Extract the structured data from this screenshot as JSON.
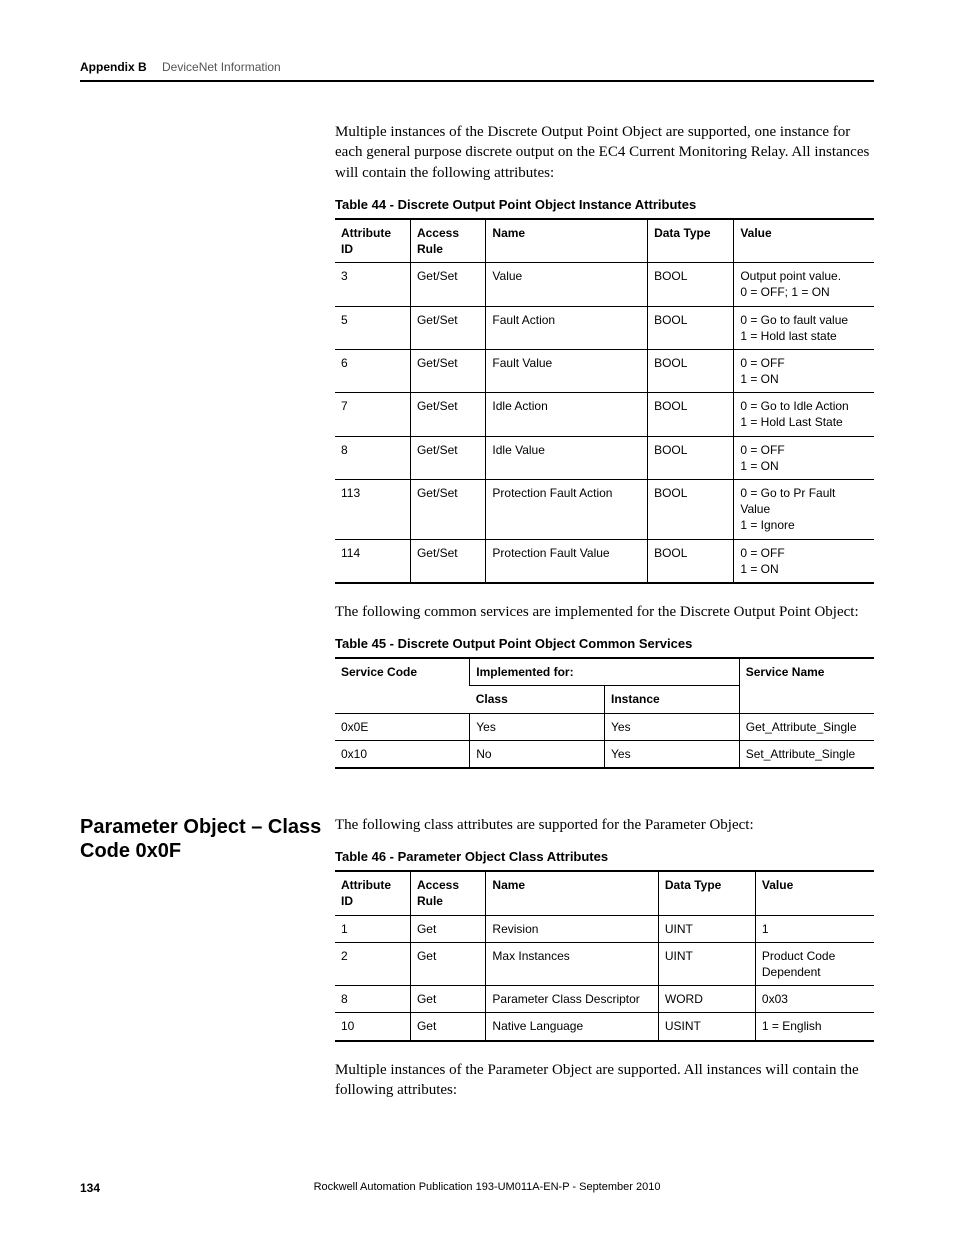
{
  "header": {
    "appendix": "Appendix B",
    "title": "DeviceNet Information"
  },
  "intro_para": "Multiple instances of the Discrete Output Point Object are supported, one instance for each general purpose discrete output on the EC4 Current Monitoring Relay. All instances will contain the following attributes:",
  "table44": {
    "caption": "Table 44 - Discrete Output Point Object Instance Attributes",
    "headers": [
      "Attribute ID",
      "Access Rule",
      "Name",
      "Data Type",
      "Value"
    ],
    "rows": [
      [
        "3",
        "Get/Set",
        "Value",
        "BOOL",
        "Output point value.\n0 = OFF; 1 = ON"
      ],
      [
        "5",
        "Get/Set",
        "Fault Action",
        "BOOL",
        "0 = Go to fault value\n1 = Hold last state"
      ],
      [
        "6",
        "Get/Set",
        "Fault Value",
        "BOOL",
        "0 = OFF\n1 = ON"
      ],
      [
        "7",
        "Get/Set",
        "Idle Action",
        "BOOL",
        "0 = Go to Idle Action\n1 = Hold Last State"
      ],
      [
        "8",
        "Get/Set",
        "Idle Value",
        "BOOL",
        "0 = OFF\n1 = ON"
      ],
      [
        "113",
        "Get/Set",
        "Protection Fault Action",
        "BOOL",
        "0 = Go to Pr Fault Value\n1 = Ignore"
      ],
      [
        "114",
        "Get/Set",
        "Protection Fault Value",
        "BOOL",
        "0 = OFF\n1 = ON"
      ]
    ]
  },
  "para_after_44": "The following common services are implemented for the Discrete Output Point Object:",
  "table45": {
    "caption": "Table 45 - Discrete Output Point Object Common Services",
    "header_row1": {
      "c1": "Service Code",
      "c2": "Implemented for:",
      "c3": "Service Name"
    },
    "header_row2": {
      "c1": "Class",
      "c2": "Instance"
    },
    "rows": [
      [
        "0x0E",
        "Yes",
        "Yes",
        "Get_Attribute_Single"
      ],
      [
        "0x10",
        "No",
        "Yes",
        "Set_Attribute_Single"
      ]
    ]
  },
  "section_heading": "Parameter Object – Class Code 0x0F",
  "para_param_intro": "The following class attributes are supported for the Parameter Object:",
  "table46": {
    "caption": "Table 46 - Parameter Object Class Attributes",
    "headers": [
      "Attribute ID",
      "Access Rule",
      "Name",
      "Data Type",
      "Value"
    ],
    "rows": [
      [
        "1",
        "Get",
        "Revision",
        "UINT",
        "1"
      ],
      [
        "2",
        "Get",
        "Max Instances",
        "UINT",
        "Product Code Dependent"
      ],
      [
        "8",
        "Get",
        "Parameter Class Descriptor",
        "WORD",
        "0x03"
      ],
      [
        "10",
        "Get",
        "Native Language",
        "USINT",
        "1 = English"
      ]
    ]
  },
  "para_after_46": "Multiple instances of the Parameter Object are supported. All instances will contain the following attributes:",
  "footer": {
    "page": "134",
    "pub": "Rockwell Automation Publication 193-UM011A-EN-P - September 2010"
  }
}
